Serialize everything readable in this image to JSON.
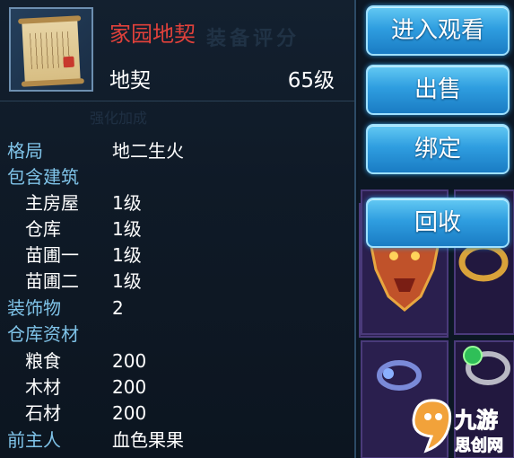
{
  "item": {
    "name": "家园地契",
    "type": "地契",
    "level": "65级",
    "name_color": "#e0413b"
  },
  "attributes": [
    {
      "label": "格局",
      "value": "地二生火",
      "kind": "main"
    },
    {
      "label": "包含建筑",
      "value": "",
      "kind": "main"
    },
    {
      "label": "主房屋",
      "value": "1级",
      "kind": "sub"
    },
    {
      "label": "仓库",
      "value": "1级",
      "kind": "sub"
    },
    {
      "label": "苗圃一",
      "value": "1级",
      "kind": "sub"
    },
    {
      "label": "苗圃二",
      "value": "1级",
      "kind": "sub"
    },
    {
      "label": "装饰物",
      "value": "2",
      "kind": "main"
    },
    {
      "label": "仓库资材",
      "value": "",
      "kind": "main"
    },
    {
      "label": "粮食",
      "value": "200",
      "kind": "sub"
    },
    {
      "label": "木材",
      "value": "200",
      "kind": "sub"
    },
    {
      "label": "石材",
      "value": "200",
      "kind": "sub"
    },
    {
      "label": "前主人",
      "value": "血色果果",
      "kind": "main"
    }
  ],
  "buttons": {
    "view": "进入观看",
    "sell": "出售",
    "bind": "绑定",
    "recycle": "回收"
  },
  "background_text": {
    "title_faint": "装备评分",
    "sub_faint": "强化加成"
  },
  "inventory_icons": [
    "demon-mask-icon",
    "gold-ring-icon",
    "green-gem-ring-icon",
    "blue-gem-earring-icon"
  ],
  "watermark": {
    "text1": "九游",
    "text2": "思创网"
  },
  "colors": {
    "label_blue": "#7fc3e8",
    "button_blue": "#2f9ee0"
  }
}
